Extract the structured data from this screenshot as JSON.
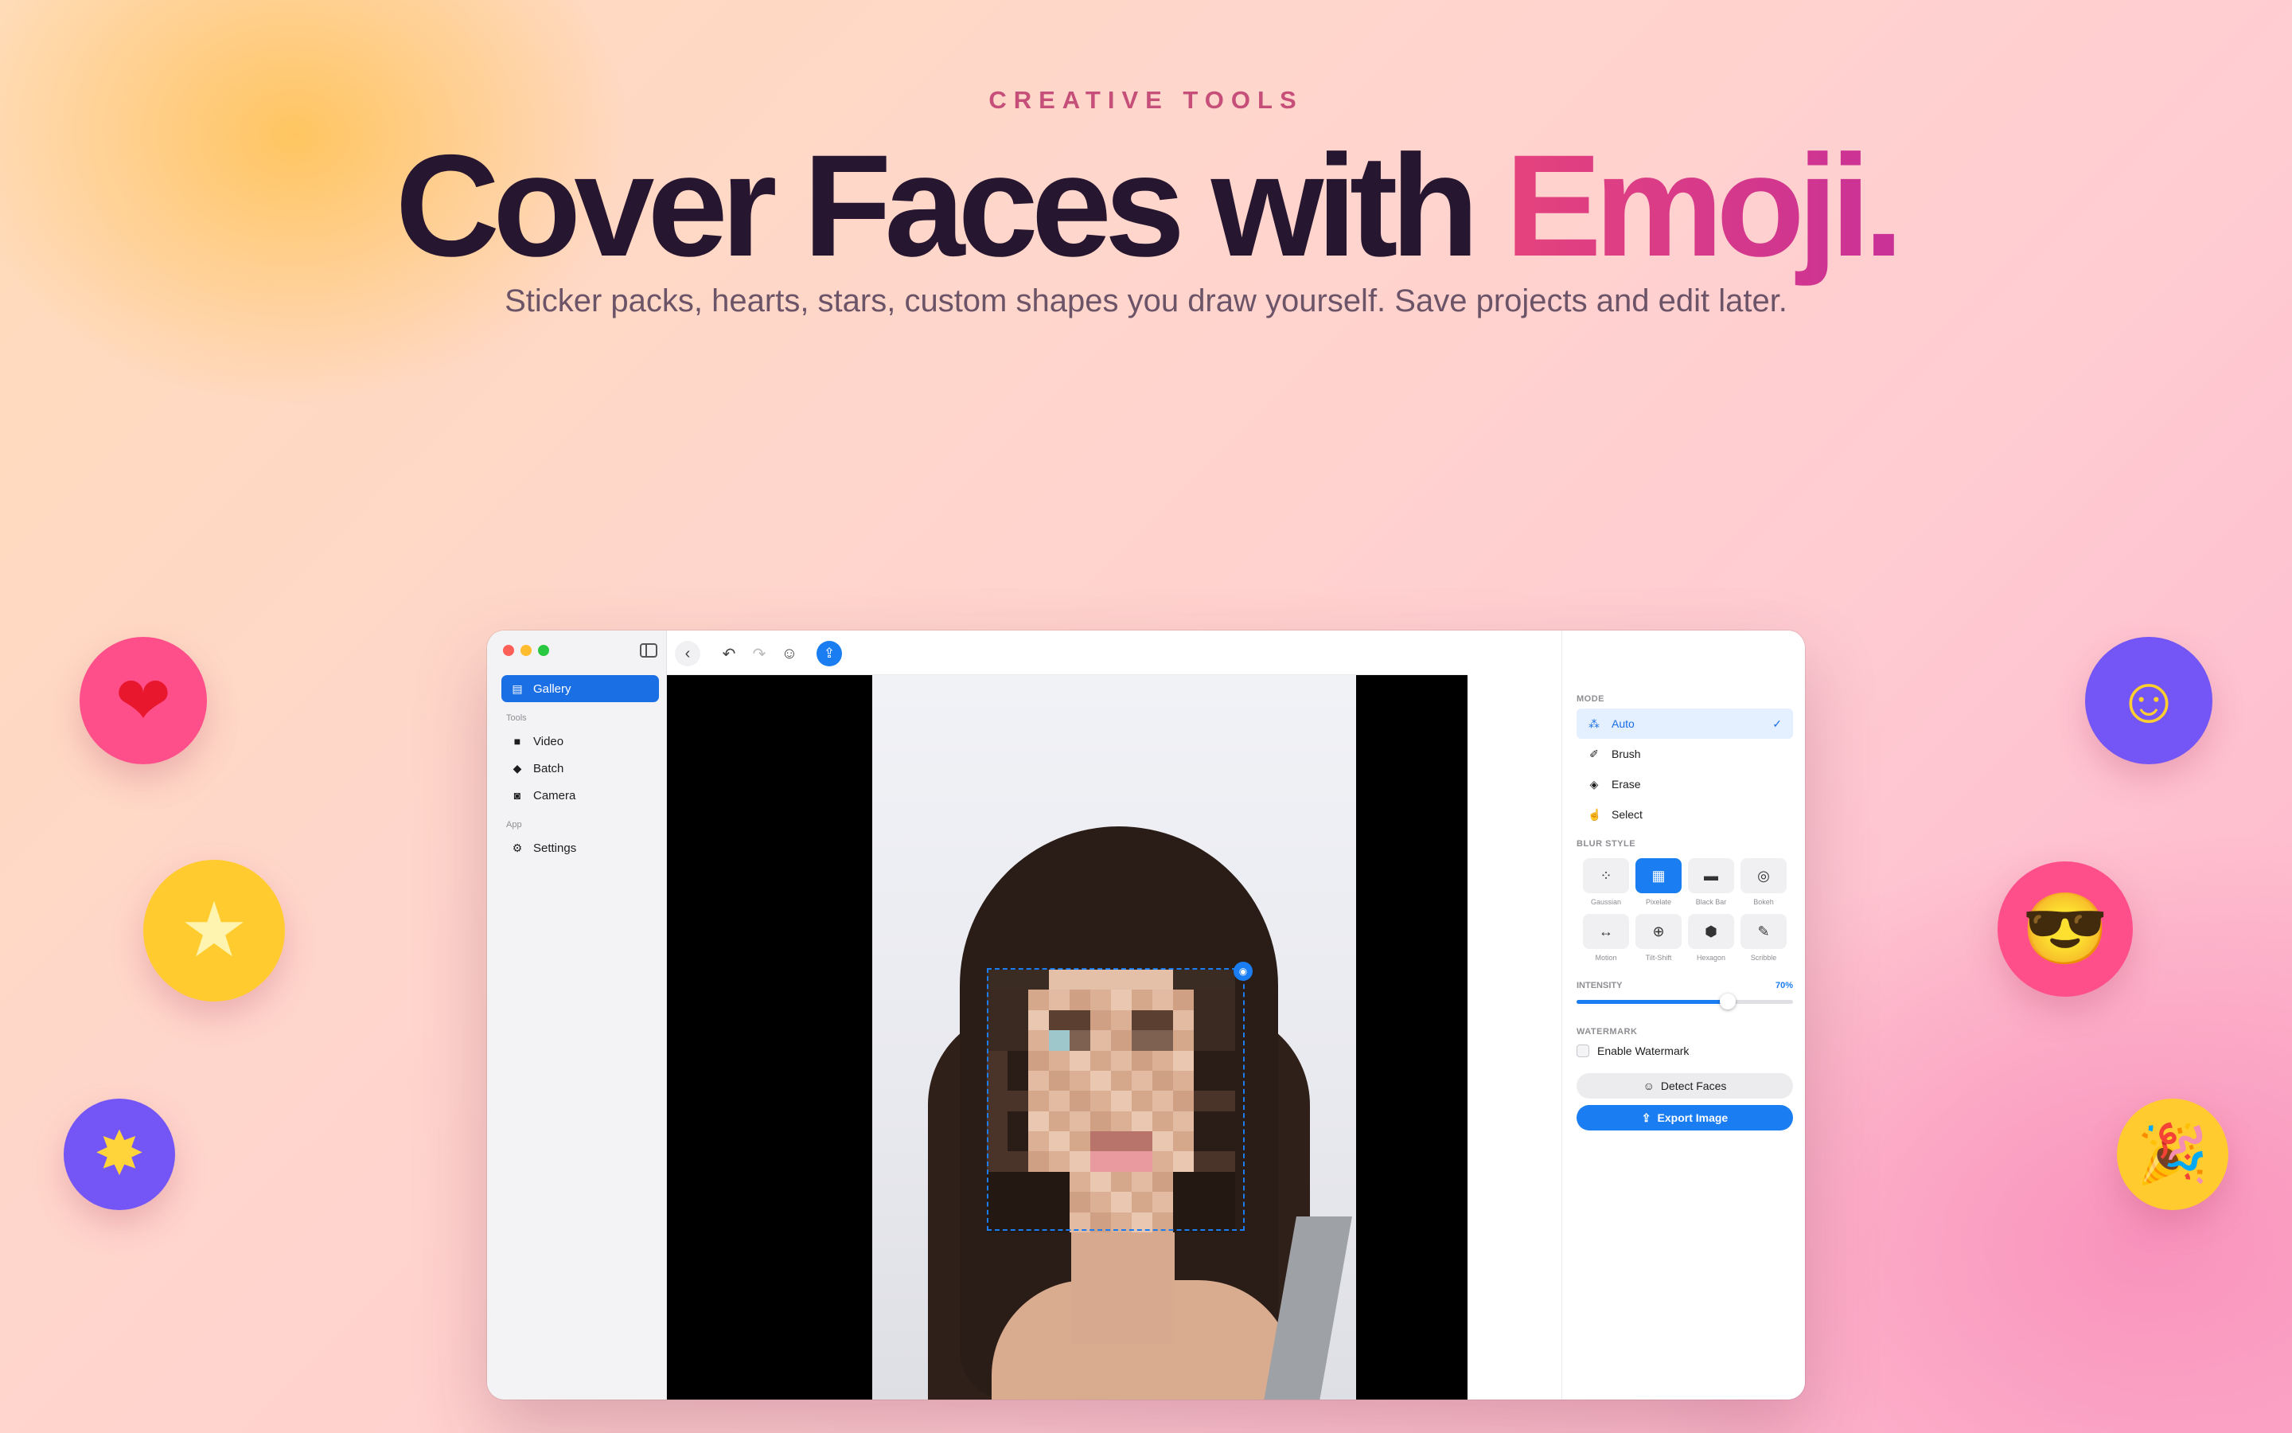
{
  "hero": {
    "kicker": "CREATIVE TOOLS",
    "headline_main": "Cover Faces with ",
    "headline_accent": "Emoji.",
    "subtitle": "Sticker packs, hearts, stars, custom shapes you draw yourself. Save projects and edit later."
  },
  "decor": {
    "left": [
      {
        "icon": "heart-icon",
        "glyph": "❤",
        "bg": "#ff4f8b"
      },
      {
        "icon": "star-icon",
        "glyph": "★",
        "bg": "#ffcb2e"
      },
      {
        "icon": "sparkle-star-icon",
        "glyph": "✸",
        "bg": "#7356f5"
      }
    ],
    "right": [
      {
        "icon": "smile-emoji-icon",
        "glyph": "☺",
        "bg": "#7356f5"
      },
      {
        "icon": "sunglasses-emoji-icon",
        "glyph": "😎",
        "bg": "#ff4f8b"
      },
      {
        "icon": "party-popper-icon",
        "glyph": "🎉",
        "bg": "#ffcb2e"
      }
    ]
  },
  "window": {
    "traffic_colors": [
      "#ff5f57",
      "#febc2e",
      "#28c840"
    ],
    "sidebar": {
      "primary": {
        "label": "Gallery",
        "icon": "gallery-icon"
      },
      "groups": [
        {
          "title": "Tools",
          "items": [
            {
              "label": "Video",
              "icon": "video-icon"
            },
            {
              "label": "Batch",
              "icon": "batch-icon"
            },
            {
              "label": "Camera",
              "icon": "camera-icon"
            }
          ]
        },
        {
          "title": "App",
          "items": [
            {
              "label": "Settings",
              "icon": "gear-icon"
            }
          ]
        }
      ]
    },
    "toolbar": {
      "icons": [
        "back-icon",
        "undo-icon",
        "redo-icon",
        "emoji-icon",
        "share-icon"
      ]
    },
    "panel": {
      "mode_title": "MODE",
      "modes": [
        {
          "label": "Auto",
          "icon": "wand-icon",
          "selected": true
        },
        {
          "label": "Brush",
          "icon": "brush-icon",
          "selected": false
        },
        {
          "label": "Erase",
          "icon": "eraser-icon",
          "selected": false
        },
        {
          "label": "Select",
          "icon": "pointer-icon",
          "selected": false
        }
      ],
      "blur_style_title": "BLUR STYLE",
      "blur_styles": [
        {
          "label": "Gaussian",
          "icon": "gaussian-icon",
          "glyph": "⁘",
          "active": false
        },
        {
          "label": "Pixelate",
          "icon": "pixelate-icon",
          "glyph": "▦",
          "active": true
        },
        {
          "label": "Black Bar",
          "icon": "black-bar-icon",
          "glyph": "▬",
          "active": false
        },
        {
          "label": "Bokeh",
          "icon": "bokeh-icon",
          "glyph": "◎",
          "active": false
        },
        {
          "label": "Motion",
          "icon": "motion-icon",
          "glyph": "↔",
          "active": false
        },
        {
          "label": "Tilt-Shift",
          "icon": "tilt-shift-icon",
          "glyph": "⊕",
          "active": false
        },
        {
          "label": "Hexagon",
          "icon": "hexagon-icon",
          "glyph": "⬢",
          "active": false
        },
        {
          "label": "Scribble",
          "icon": "scribble-icon",
          "glyph": "✎",
          "active": false
        }
      ],
      "intensity_title": "INTENSITY",
      "intensity_value": "70%",
      "intensity_fraction": 0.7,
      "watermark_title": "WATERMARK",
      "watermark_label": "Enable Watermark",
      "watermark_enabled": false,
      "detect_label": "Detect Faces",
      "export_label": "Export Image"
    },
    "accent_color": "#1a7df2"
  }
}
